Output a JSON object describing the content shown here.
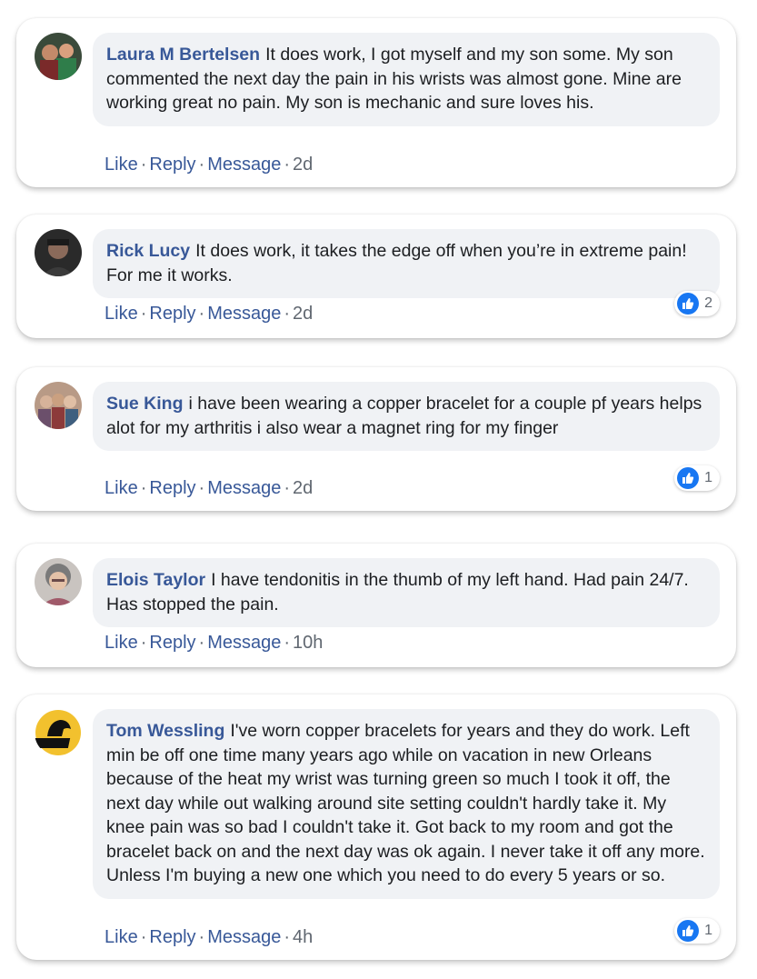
{
  "comments": [
    {
      "author": "Laura M Bertelsen",
      "text": "It does work, I got myself and my son some. My son commented the next day the pain in his wrists was almost gone. Mine are working great no pain. My son is mechanic and sure loves his.",
      "like_label": "Like",
      "reply_label": "Reply",
      "message_label": "Message",
      "time": "2d",
      "reactions": null
    },
    {
      "author": "Rick Lucy",
      "text": "It does work, it takes the edge off when you’re in extreme pain! For me it works.",
      "like_label": "Like",
      "reply_label": "Reply",
      "message_label": "Message",
      "time": "2d",
      "reactions": "2"
    },
    {
      "author": "Sue King",
      "text": "i have been wearing a copper bracelet for a couple pf years helps alot for my arthritis i also wear a magnet ring for my finger",
      "like_label": "Like",
      "reply_label": "Reply",
      "message_label": "Message",
      "time": "2d",
      "reactions": "1"
    },
    {
      "author": "Elois Taylor",
      "text": "I have tendonitis in the thumb of my left hand. Had pain 24/7. Has stopped the pain.",
      "like_label": "Like",
      "reply_label": "Reply",
      "message_label": "Message",
      "time": "10h",
      "reactions": null
    },
    {
      "author": "Tom Wessling",
      "text": "I've worn copper bracelets for years and they do work. Left min be off one time many years ago while on vacation in new Orleans because of the heat my wrist was turning green so much I took it off, the next day while out walking around site setting couldn't hardly take it. My knee pain was so bad I couldn't take it. Got back to my room and got the bracelet back on and the next day was ok again. I never take it off any more. Unless I'm buying a new one which you need to do every 5 years or so.",
      "like_label": "Like",
      "reply_label": "Reply",
      "message_label": "Message",
      "time": "4h",
      "reactions": "1"
    }
  ],
  "separator": "·",
  "colors": {
    "author": "#385898",
    "bubble": "#f0f2f5",
    "like_badge": "#1877f2",
    "meta": "#606770"
  },
  "icons": {
    "reaction": "thumbs-up-icon",
    "avatar": "profile-photo"
  }
}
